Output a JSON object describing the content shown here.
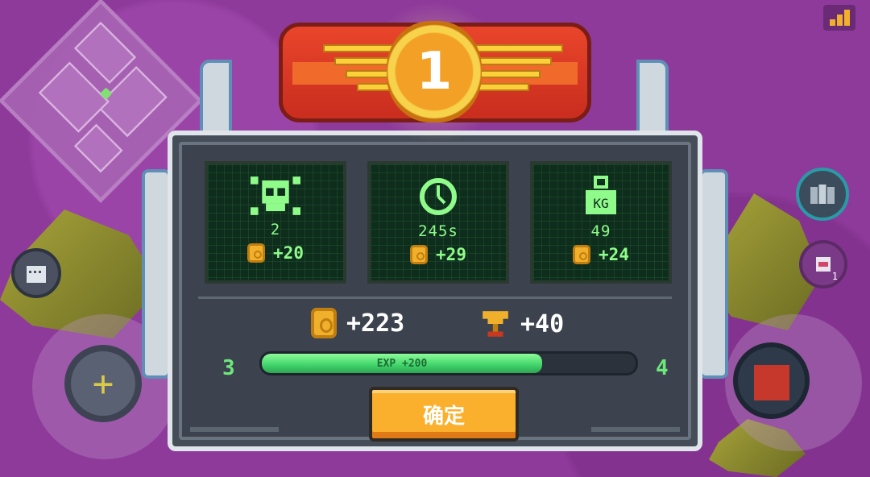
{
  "rank": "1",
  "stats": [
    {
      "icon": "skull-icon",
      "value": "2",
      "reward": "+20"
    },
    {
      "icon": "clock-icon",
      "value": "245s",
      "reward": "+29"
    },
    {
      "icon": "weight-icon",
      "icon_label": "KG",
      "value": "49",
      "reward": "+24"
    }
  ],
  "totals": {
    "coins": "+223",
    "trophies": "+40"
  },
  "level": {
    "current": "3",
    "next": "4",
    "exp_label": "EXP +200",
    "progress_fraction": 0.75
  },
  "confirm_label": "确定",
  "side_badge": "1",
  "colors": {
    "accent_green": "#8ffb8a",
    "coin": "#f1b02c",
    "banner_red": "#e9452b",
    "button": "#fbb02d"
  }
}
